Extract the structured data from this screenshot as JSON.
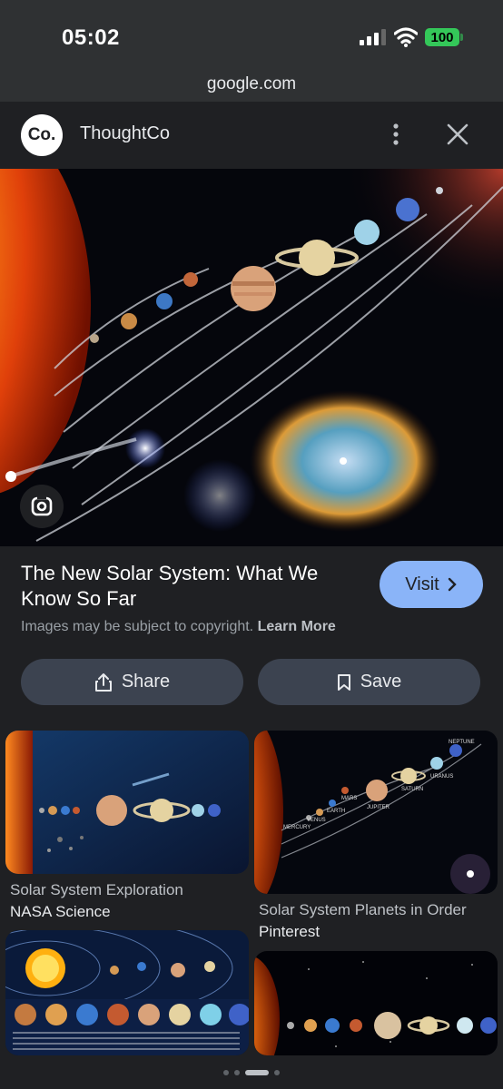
{
  "status_bar": {
    "time": "05:02",
    "battery": "100",
    "url": "google.com"
  },
  "source": {
    "logo_text": "Co.",
    "name": "ThoughtCo"
  },
  "result": {
    "title": "The New Solar System: What We Know So Far",
    "visit_label": "Visit",
    "copyright_text": "Images may be subject to copyright.",
    "learn_more_label": "Learn More",
    "share_label": "Share",
    "save_label": "Save"
  },
  "related": [
    {
      "title": "Solar System Exploration",
      "source": "NASA Science"
    },
    {
      "title": "Solar System Planets in Order",
      "source": "Pinterest"
    }
  ],
  "thumb2_labels": [
    "MERCURY",
    "VENUS",
    "EARTH",
    "MARS",
    "JUPITER",
    "SATURN",
    "URANUS",
    "NEPTUNE"
  ],
  "pager": {
    "count": 4,
    "active": 2
  },
  "colors": {
    "accent": "#8ab4f8",
    "background": "#1f2023",
    "battery": "#34c759"
  },
  "icons": [
    "signal-icon",
    "wifi-icon",
    "more-vert-icon",
    "close-icon",
    "lens-icon",
    "chevron-right-icon",
    "share-icon",
    "bookmark-icon"
  ]
}
